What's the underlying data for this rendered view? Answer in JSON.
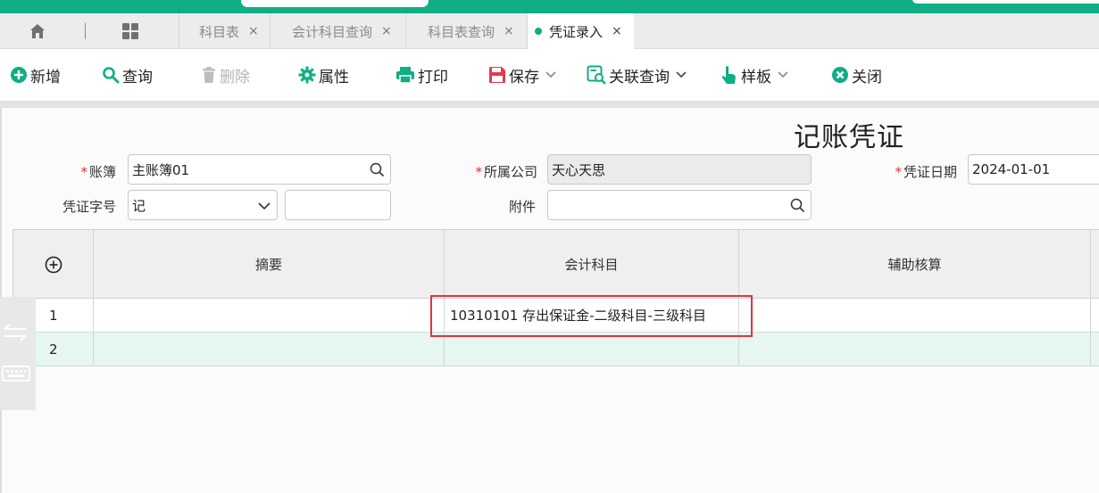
{
  "colors": {
    "brand": "#0fae84",
    "required": "#e03030",
    "highlight_box": "#e0343b"
  },
  "tabs": [
    {
      "label": "科目表",
      "active": false
    },
    {
      "label": "会计科目查询",
      "active": false
    },
    {
      "label": "科目表查询",
      "active": false
    },
    {
      "label": "凭证录入",
      "active": true
    }
  ],
  "tab_close_glyph": "×",
  "toolbar": {
    "add": "新增",
    "query": "查询",
    "delete": "删除",
    "properties": "属性",
    "print": "打印",
    "save": "保存",
    "related_query": "关联查询",
    "template": "样板",
    "close": "关闭"
  },
  "form": {
    "title": "记账凭证",
    "required_mark": "*",
    "ledger_label": "账簿",
    "ledger_value": "主账簿01",
    "company_label": "所属公司",
    "company_value": "天心天思",
    "date_label": "凭证日期",
    "date_value": "2024-01-01",
    "voucher_word_label": "凭证字号",
    "voucher_word_value": "记",
    "voucher_number_value": "",
    "attachment_label": "附件",
    "attachment_value": ""
  },
  "grid": {
    "columns": [
      "摘要",
      "会计科目",
      "辅助核算"
    ],
    "rows": [
      {
        "num": "1",
        "summary": "",
        "account": "10310101 存出保证金-二级科目-三级科目",
        "aux": ""
      },
      {
        "num": "2",
        "summary": "",
        "account": "",
        "aux": ""
      }
    ]
  },
  "icons": [
    "home-icon",
    "grid-icon",
    "plus-circle-icon",
    "search-icon",
    "trash-icon",
    "gear-icon",
    "printer-icon",
    "save-icon",
    "related-query-icon",
    "pointer-icon",
    "close-circle-icon",
    "chevron-down-icon",
    "swap-icon",
    "keyboard-icon"
  ]
}
